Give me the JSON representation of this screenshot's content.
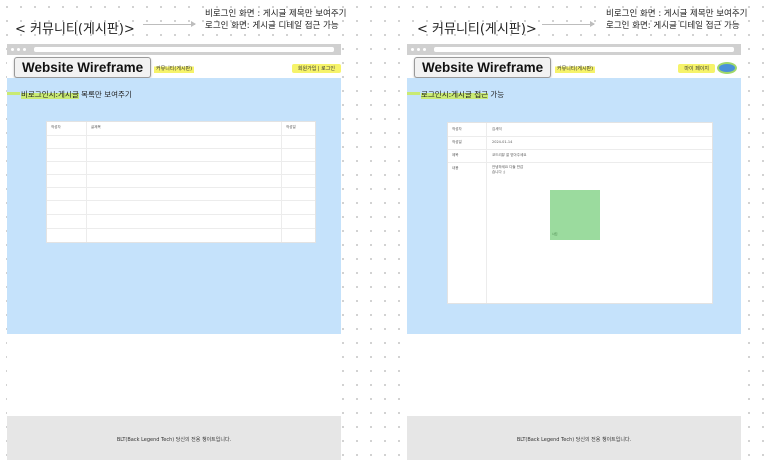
{
  "left": {
    "heading": "< 커뮤니티(게시판)>",
    "note_line1": "비로그인 화면 : 게시글 제목만 보여주기",
    "note_line2": "로그인 화면: 게시글 디테일 접근 가능",
    "logo": "Website Wireframe",
    "nav_link": "커뮤니티(게시판)",
    "header_right": "회원가입 | 로그인",
    "section_highlight": "비로그인시:게시글",
    "section_rest": " 목록만 보여주기",
    "board_headers": [
      "작성자",
      "글제목",
      "작성일"
    ],
    "footer_text": "BLT(Back Legend Tech)   당신의 전용 챙이트입니다."
  },
  "right": {
    "heading": "< 커뮤니티(게시판)>",
    "note_line1": "비로그인 화면 : 게시글 제목만 보여주기",
    "note_line2": "로그인 화면: 게시글 디테일 접근 가능",
    "logo": "Website Wireframe",
    "nav_link": "커뮤니티(게시판)",
    "header_right": "마이 페이지",
    "section_highlight": "로그인시:게시글 접근",
    "section_rest": " 가능",
    "detail_rows": [
      {
        "key": "작성자",
        "value": "김세익"
      },
      {
        "key": "작성일",
        "value": "2024-01-14"
      },
      {
        "key": "제목",
        "value": "코드리뷰 잘 받아주세요"
      }
    ],
    "content_key": "내용",
    "content_line1": "안녕하세요 다들 반갑",
    "content_line2": "습니다 ;)",
    "image_caption": "사진",
    "footer_text": "BLT(Back Legend Tech)   당신의 전용 챙이트입니다."
  }
}
